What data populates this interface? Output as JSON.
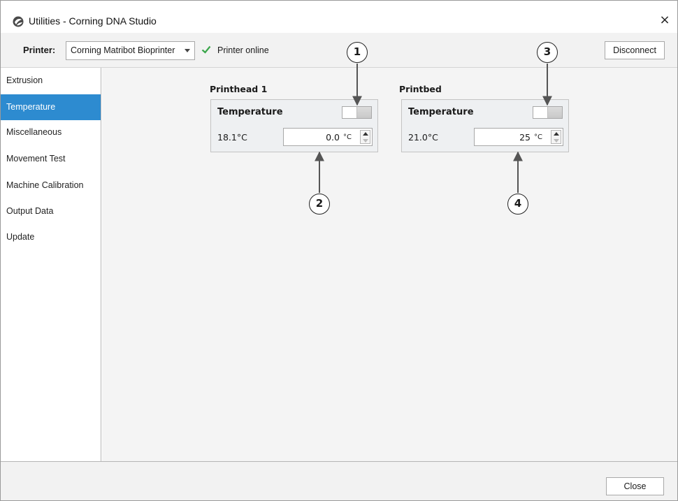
{
  "window": {
    "title": "Utilities - Corning DNA Studio",
    "app_icon": "corning-logo-icon",
    "close_icon": "close-icon",
    "close_glyph": "×"
  },
  "toolbar": {
    "printer_label": "Printer:",
    "printer_selected": "Corning Matribot Bioprinter",
    "status_icon": "check-icon",
    "status_text": "Printer online",
    "status_color": "#3aa64a",
    "disconnect_label": "Disconnect"
  },
  "sidebar": {
    "accent_color": "#2d8bd0",
    "items": [
      {
        "label": "Extrusion",
        "active": false
      },
      {
        "label": "Temperature",
        "active": true
      },
      {
        "label": "Miscellaneous",
        "active": false
      },
      {
        "label": "Movement Test",
        "active": false
      },
      {
        "label": "Machine Calibration",
        "active": false
      },
      {
        "label": "Output Data",
        "active": false
      },
      {
        "label": "Update",
        "active": false
      }
    ]
  },
  "printhead": {
    "section_title": "Printhead 1",
    "box_title": "Temperature",
    "toggle_on": false,
    "current_temp": "18.1°C",
    "setpoint": "0.0",
    "unit": "°C"
  },
  "printbed": {
    "section_title": "Printbed",
    "box_title": "Temperature",
    "toggle_on": false,
    "current_temp": "21.0°C",
    "setpoint": "25",
    "unit": "°C"
  },
  "callouts": {
    "c1": "1",
    "c2": "2",
    "c3": "3",
    "c4": "4"
  },
  "footer": {
    "close_label": "Close"
  }
}
